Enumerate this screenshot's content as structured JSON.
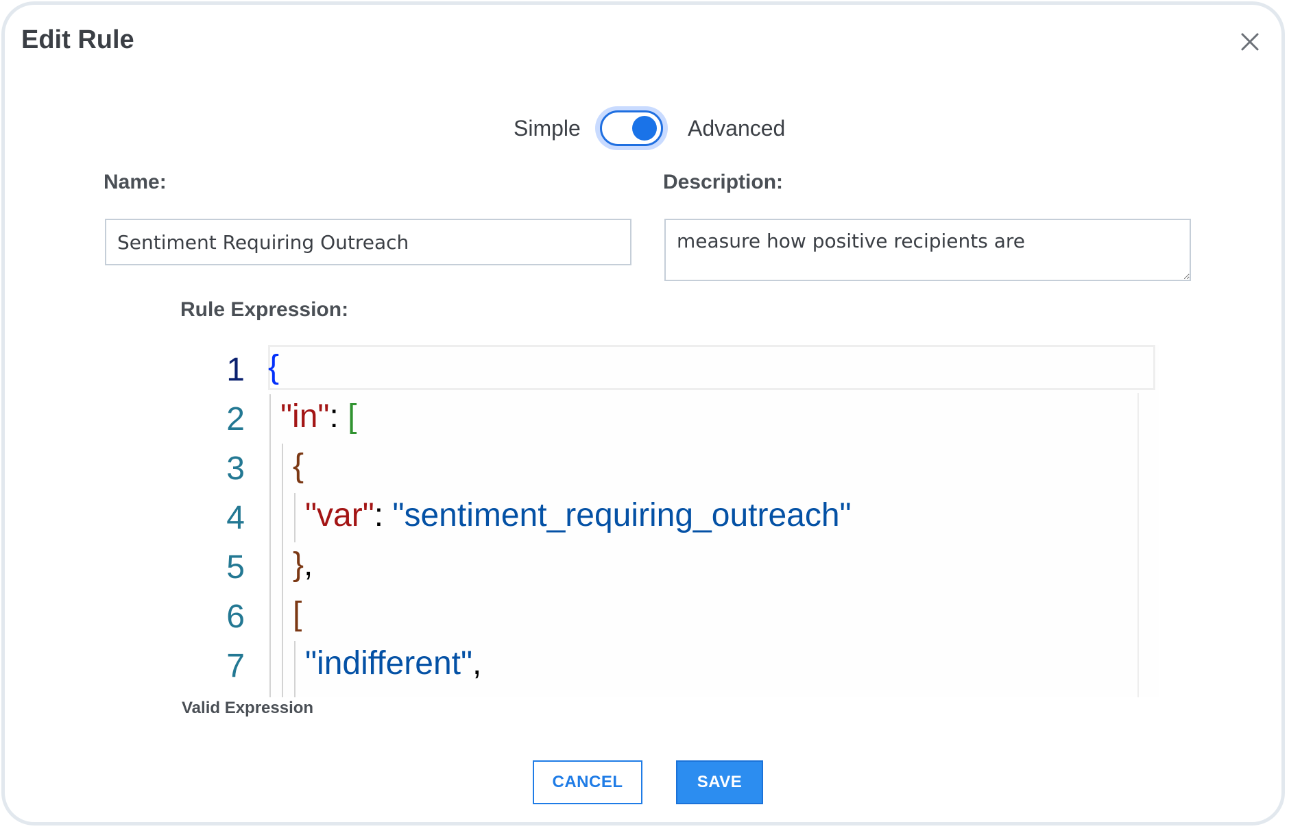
{
  "dialog": {
    "title": "Edit Rule",
    "close_icon": "close-icon"
  },
  "mode_toggle": {
    "left_label": "Simple",
    "right_label": "Advanced",
    "selected": "Advanced"
  },
  "form": {
    "name_label": "Name:",
    "name_value": "Sentiment Requiring Outreach",
    "description_label": "Description:",
    "description_value": "measure how positive recipients are",
    "expression_label": "Rule Expression:"
  },
  "editor": {
    "line_numbers": [
      "1",
      "2",
      "3",
      "4",
      "5",
      "6",
      "7"
    ],
    "lines": [
      [
        {
          "t": "{",
          "c": "tok-brace1"
        }
      ],
      [
        {
          "t": "\"in\"",
          "c": "tok-key"
        },
        {
          "t": ": ",
          "c": "tok-punct"
        },
        {
          "t": "[",
          "c": "tok-bracket2"
        }
      ],
      [
        {
          "t": "{",
          "c": "tok-brace3"
        }
      ],
      [
        {
          "t": "\"var\"",
          "c": "tok-key"
        },
        {
          "t": ": ",
          "c": "tok-punct"
        },
        {
          "t": "\"sentiment_requiring_outreach\"",
          "c": "tok-str"
        }
      ],
      [
        {
          "t": "}",
          "c": "tok-brace3"
        },
        {
          "t": ",",
          "c": "tok-punct"
        }
      ],
      [
        {
          "t": "[",
          "c": "tok-brace3"
        }
      ],
      [
        {
          "t": "\"indifferent\"",
          "c": "tok-str"
        },
        {
          "t": ",",
          "c": "tok-punct"
        }
      ]
    ],
    "status": "Valid Expression"
  },
  "footer": {
    "cancel_label": "CANCEL",
    "save_label": "SAVE"
  },
  "colors": {
    "accent": "#1f7ce6",
    "save_bg": "#2c8df0",
    "toggle_on": "#1a73e8",
    "json_key": "#a31515",
    "json_string": "#0451a5"
  }
}
